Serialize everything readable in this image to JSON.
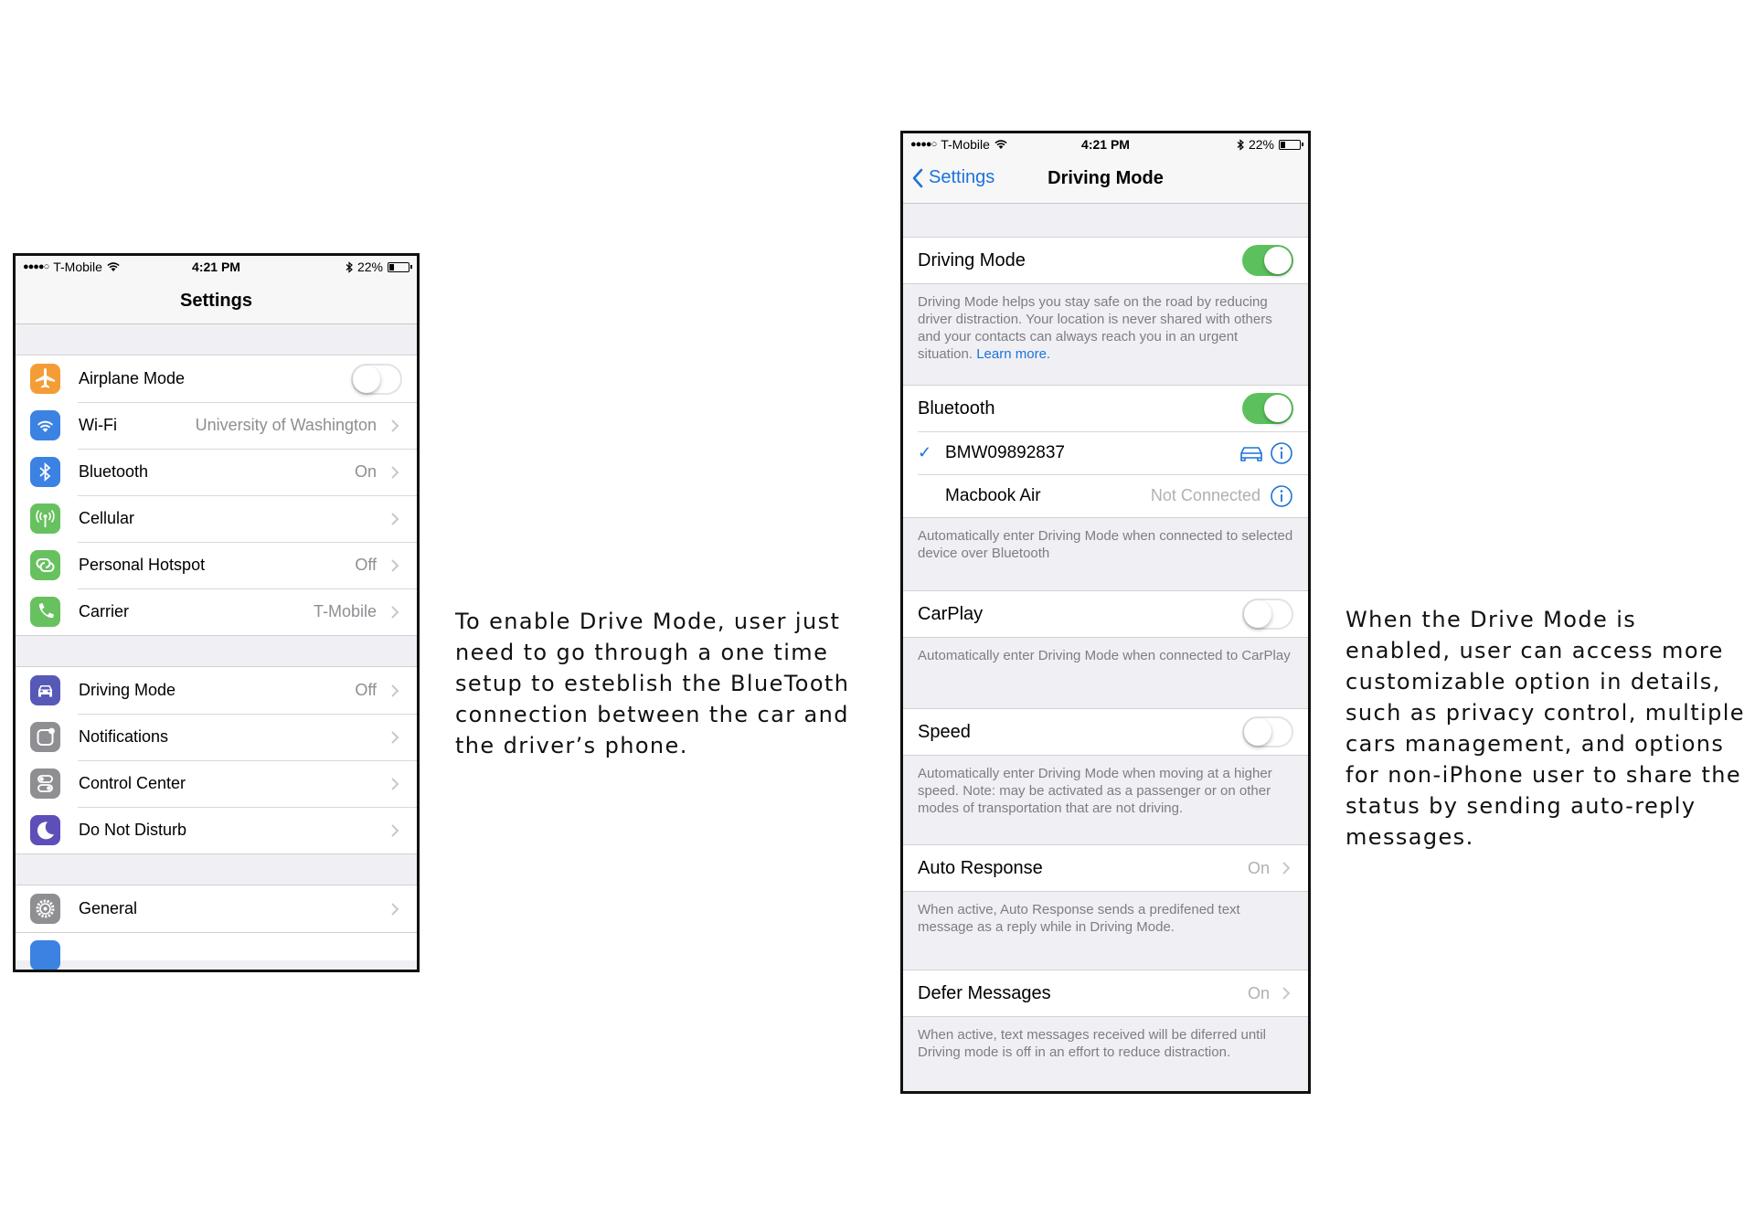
{
  "phone1": {
    "status": {
      "carrier": "T-Mobile",
      "time": "4:21 PM",
      "battery": "22%",
      "battery_level": 0.22
    },
    "title": "Settings",
    "group1": [
      {
        "label": "Airplane Mode",
        "value": "",
        "icon": "airplane-icon",
        "color": "#f49d37",
        "toggle": "off"
      },
      {
        "label": "Wi-Fi",
        "value": "University of Washington",
        "icon": "wifi-icon",
        "color": "#3b82e2"
      },
      {
        "label": "Bluetooth",
        "value": "On",
        "icon": "bluetooth-icon",
        "color": "#3b82e2"
      },
      {
        "label": "Cellular",
        "value": "",
        "icon": "cellular-icon",
        "color": "#67c15f"
      },
      {
        "label": "Personal Hotspot",
        "value": "Off",
        "icon": "hotspot-icon",
        "color": "#67c15f"
      },
      {
        "label": "Carrier",
        "value": "T-Mobile",
        "icon": "phone-icon",
        "color": "#67c15f"
      }
    ],
    "group2": [
      {
        "label": "Driving Mode",
        "value": "Off",
        "icon": "car-icon",
        "color": "#5659b8"
      },
      {
        "label": "Notifications",
        "value": "",
        "icon": "notifications-icon",
        "color": "#8e8e93"
      },
      {
        "label": "Control Center",
        "value": "",
        "icon": "control-center-icon",
        "color": "#8e8e93"
      },
      {
        "label": "Do Not Disturb",
        "value": "",
        "icon": "moon-icon",
        "color": "#5d4fb9"
      }
    ],
    "group3": [
      {
        "label": "General",
        "value": "",
        "icon": "gear-icon",
        "color": "#8e8e93"
      }
    ]
  },
  "caption1": "To enable Drive Mode, user just need to go through a one time setup to esteblish the BlueTooth connection between the car and the driver’s phone.",
  "phone2": {
    "status": {
      "carrier": "T-Mobile",
      "time": "4:21 PM",
      "battery": "22%",
      "battery_level": 0.22
    },
    "back_label": "Settings",
    "title": "Driving Mode",
    "driving_mode": {
      "label": "Driving Mode",
      "toggle": "on",
      "footer": "Driving Mode helps you stay safe on the road by reducing driver distraction. Your location is never shared with others and your contacts can always reach you in an urgent situation.",
      "footer_link": "Learn more."
    },
    "bluetooth": {
      "label": "Bluetooth",
      "toggle": "on",
      "devices": [
        {
          "name": "BMW09892837",
          "status": "",
          "checked": true
        },
        {
          "name": "Macbook Air",
          "status": "Not Connected",
          "checked": false
        }
      ],
      "footer": "Automatically enter Driving Mode when connected to selected device over Bluetooth"
    },
    "carplay": {
      "label": "CarPlay",
      "toggle": "off",
      "footer": "Automatically enter Driving Mode when connected to CarPlay"
    },
    "speed": {
      "label": "Speed",
      "toggle": "off",
      "footer": "Automatically enter Driving Mode when moving at a higher speed. Note: may be activated as a passenger or on other modes of transportation that are not driving."
    },
    "auto_response": {
      "label": "Auto Response",
      "value": "On",
      "footer": "When active, Auto Response sends a predifened text message as a reply while in Driving Mode."
    },
    "defer": {
      "label": "Defer Messages",
      "value": "On",
      "footer": "When active, text messages received will be diferred until Driving mode is off in an effort to reduce distraction."
    }
  },
  "caption2": "When the Drive Mode is enabled, user can access more customizable option in details, such as privacy control, multiple cars management, and options for non-iPhone user to share the status by sending auto-reply messages."
}
